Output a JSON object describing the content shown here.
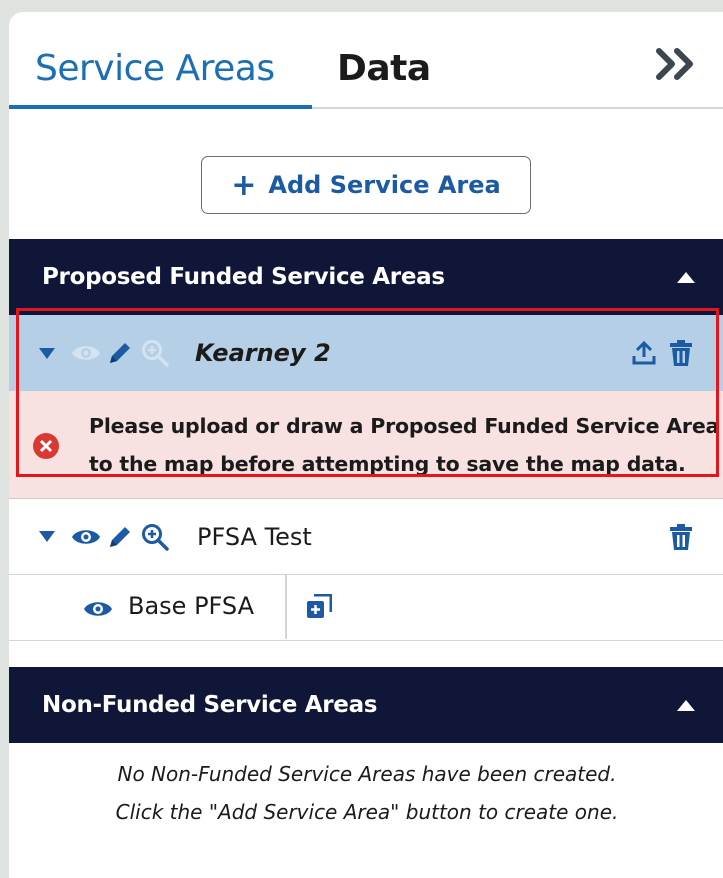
{
  "tabs": {
    "service_areas": "Service Areas",
    "data": "Data",
    "collapse": "»"
  },
  "add_button": {
    "plus": "+",
    "label": "Add Service Area"
  },
  "proposed_section": {
    "title": "Proposed Funded Service Areas",
    "areas": [
      {
        "name": "Kearney 2",
        "selected": true,
        "error": "Please upload or draw a Proposed Funded Service Area to the map before attempting to save the map data.",
        "error_line1": "Please upload or draw a Proposed Funded Service Area",
        "error_line2": "to the map before attempting to save the map data."
      },
      {
        "name": "PFSA Test",
        "selected": false,
        "sub_items": [
          {
            "name": "Base PFSA"
          }
        ]
      }
    ]
  },
  "nonfunded_section": {
    "title": "Non-Funded Service Areas",
    "empty_line1": "No Non-Funded Service Areas have been created.",
    "empty_line2": "Click the \"Add Service Area\" button to create one."
  },
  "colors": {
    "primary": "#1c5aa4",
    "header_bg": "#0f1638",
    "selected_bg": "#b5d0e6",
    "error_bg": "#f8e1e1",
    "error_icon": "#d83933",
    "highlight": "#e3161d"
  }
}
